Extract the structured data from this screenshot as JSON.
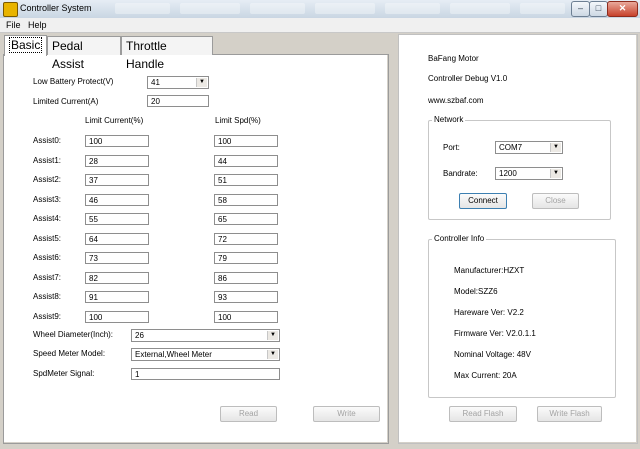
{
  "window": {
    "title": "Controller System"
  },
  "menu": {
    "file": "File",
    "help": "Help"
  },
  "tabs": [
    "Basic",
    "Pedal Assist",
    "Throttle Handle"
  ],
  "basic": {
    "low_battery_label": "Low Battery Protect(V)",
    "low_battery_value": "41",
    "limited_current_label": "Limited Current(A)",
    "limited_current_value": "20",
    "col_current": "Limit Current(%)",
    "col_speed": "Limit Spd(%)",
    "assists": [
      {
        "label": "Assist0:",
        "current": "100",
        "speed": "100"
      },
      {
        "label": "Assist1:",
        "current": "28",
        "speed": "44"
      },
      {
        "label": "Assist2:",
        "current": "37",
        "speed": "51"
      },
      {
        "label": "Assist3:",
        "current": "46",
        "speed": "58"
      },
      {
        "label": "Assist4:",
        "current": "55",
        "speed": "65"
      },
      {
        "label": "Assist5:",
        "current": "64",
        "speed": "72"
      },
      {
        "label": "Assist6:",
        "current": "73",
        "speed": "79"
      },
      {
        "label": "Assist7:",
        "current": "82",
        "speed": "86"
      },
      {
        "label": "Assist8:",
        "current": "91",
        "speed": "93"
      },
      {
        "label": "Assist9:",
        "current": "100",
        "speed": "100"
      }
    ],
    "wheel_label": "Wheel Diameter(Inch):",
    "wheel_value": "26",
    "speed_meter_label": "Speed Meter Model:",
    "speed_meter_value": "External,Wheel Meter",
    "spd_signal_label": "SpdMeter Signal:",
    "spd_signal_value": "1",
    "read_button": "Read",
    "write_button": "Write"
  },
  "right": {
    "company": "BaFang Motor",
    "debug": "Controller Debug V1.0",
    "website": "www.szbaf.com",
    "network_title": "Network",
    "port_label": "Port:",
    "port_value": "COM7",
    "baud_label": "Bandrate:",
    "baud_value": "1200",
    "connect_button": "Connect",
    "close_button": "Close",
    "info_title": "Controller Info",
    "info": [
      "Manufacturer:HZXT",
      "Model:SZZ6",
      "Hareware Ver: V2.2",
      "Firmware Ver: V2.0.1.1",
      "Nominal Voltage: 48V",
      "Max Current: 20A"
    ],
    "read_flash_button": "Read Flash",
    "write_flash_button": "Write Flash"
  }
}
